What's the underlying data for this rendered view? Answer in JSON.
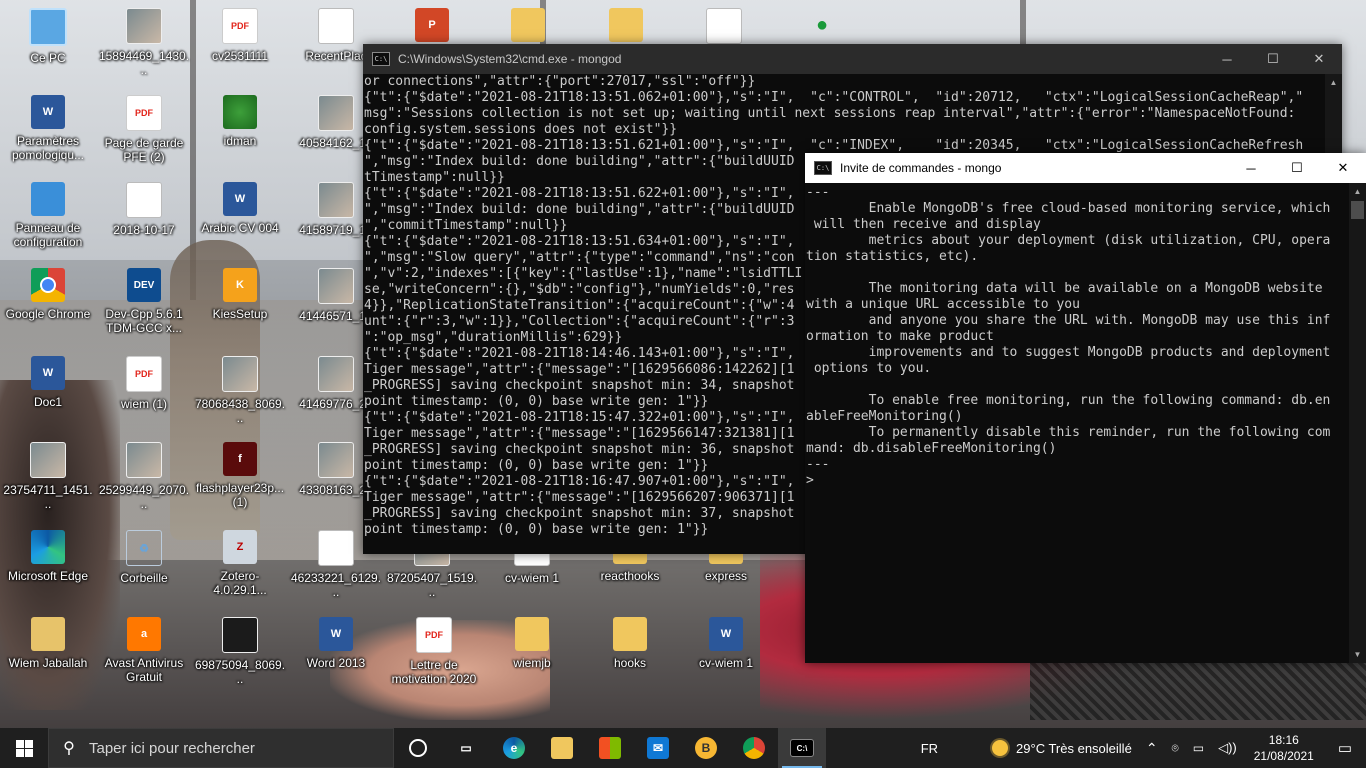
{
  "desktop": {
    "icons": [
      {
        "label": "Ce PC",
        "icon": "computer-icon"
      },
      {
        "label": "15894469_1430...",
        "icon": "photo-icon"
      },
      {
        "label": "cv2531111",
        "icon": "pdf-icon"
      },
      {
        "label": "RecentPlac",
        "icon": "recent-places-icon"
      },
      {
        "label": "Paramètres pomologiqu...",
        "icon": "word-doc-icon"
      },
      {
        "label": "Page de garde PFE (2)",
        "icon": "pdf-icon"
      },
      {
        "label": "idman",
        "icon": "idm-icon"
      },
      {
        "label": "40584162_19",
        "icon": "photo-icon"
      },
      {
        "label": "Panneau de configuration",
        "icon": "control-panel-icon"
      },
      {
        "label": "2018-10-17",
        "icon": "photo-icon"
      },
      {
        "label": "Arabic CV 004",
        "icon": "word-doc-icon"
      },
      {
        "label": "41589719_19",
        "icon": "photo-icon"
      },
      {
        "label": "Google Chrome",
        "icon": "chrome-icon"
      },
      {
        "label": "Dev-Cpp 5.6.1 TDM-GCC x...",
        "icon": "devcpp-icon"
      },
      {
        "label": "KiesSetup",
        "icon": "kies-icon"
      },
      {
        "label": "41446571_19",
        "icon": "photo-icon"
      },
      {
        "label": "Doc1",
        "icon": "word-doc-icon"
      },
      {
        "label": "wiem (1)",
        "icon": "pdf-icon"
      },
      {
        "label": "78068438_8069...",
        "icon": "photo-icon"
      },
      {
        "label": "41469776_22",
        "icon": "photo-icon"
      },
      {
        "label": "23754711_1451...",
        "icon": "photo-icon"
      },
      {
        "label": "25299449_2070...",
        "icon": "photo-icon"
      },
      {
        "label": "flashplayer23p... (1)",
        "icon": "flash-icon"
      },
      {
        "label": "43308163_21",
        "icon": "photo-icon"
      },
      {
        "label": "Microsoft Edge",
        "icon": "edge-icon"
      },
      {
        "label": "Corbeille",
        "icon": "recycle-bin-icon"
      },
      {
        "label": "Zotero-4.0.29.1...",
        "icon": "zotero-icon"
      },
      {
        "label": "46233221_6129...",
        "icon": "photo-icon"
      },
      {
        "label": "87205407_1519...",
        "icon": "photo-icon"
      },
      {
        "label": "cv-wiem 1",
        "icon": "pdf-icon"
      },
      {
        "label": "reacthooks",
        "icon": "folder-icon"
      },
      {
        "label": "express",
        "icon": "folder-icon"
      },
      {
        "label": "Wiem Jaballah",
        "icon": "user-folder-icon"
      },
      {
        "label": "Avast Antivirus Gratuit",
        "icon": "avast-icon"
      },
      {
        "label": "69875094_8069...",
        "icon": "photo-icon"
      },
      {
        "label": "Word 2013",
        "icon": "word-app-icon"
      },
      {
        "label": "Lettre de motivation 2020",
        "icon": "pdf-icon"
      },
      {
        "label": "wiemjb",
        "icon": "folder-icon"
      },
      {
        "label": "hooks",
        "icon": "folder-icon"
      },
      {
        "label": "cv-wiem 1",
        "icon": "word-doc-icon"
      }
    ]
  },
  "mongod_window": {
    "title": "C:\\Windows\\System32\\cmd.exe - mongod",
    "lines": [
      "or connections\",\"attr\":{\"port\":27017,\"ssl\":\"off\"}}",
      "{\"t\":{\"$date\":\"2021-08-21T18:13:51.062+01:00\"},\"s\":\"I\",  \"c\":\"CONTROL\",  \"id\":20712,   \"ctx\":\"LogicalSessionCacheReap\",\"",
      "msg\":\"Sessions collection is not set up; waiting until next sessions reap interval\",\"attr\":{\"error\":\"NamespaceNotFound:",
      "config.system.sessions does not exist\"}}",
      "{\"t\":{\"$date\":\"2021-08-21T18:13:51.621+01:00\"},\"s\":\"I\",  \"c\":\"INDEX\",    \"id\":20345,   \"ctx\":\"LogicalSessionCacheRefresh",
      "\",\"msg\":\"Index build: done building\",\"attr\":{\"buildUUID",
      "tTimestamp\":null}}",
      "{\"t\":{\"$date\":\"2021-08-21T18:13:51.622+01:00\"},\"s\":\"I\",",
      "\",\"msg\":\"Index build: done building\",\"attr\":{\"buildUUID",
      "\",\"commitTimestamp\":null}}",
      "{\"t\":{\"$date\":\"2021-08-21T18:13:51.634+01:00\"},\"s\":\"I\",",
      "\",\"msg\":\"Slow query\",\"attr\":{\"type\":\"command\",\"ns\":\"con",
      "\",\"v\":2,\"indexes\":[{\"key\":{\"lastUse\":1},\"name\":\"lsidTTLI",
      "se,\"writeConcern\":{},\"$db\":\"config\"},\"numYields\":0,\"res",
      "4}},\"ReplicationStateTransition\":{\"acquireCount\":{\"w\":4",
      "unt\":{\"r\":3,\"w\":1}},\"Collection\":{\"acquireCount\":{\"r\":3",
      "\":\"op_msg\",\"durationMillis\":629}}",
      "{\"t\":{\"$date\":\"2021-08-21T18:14:46.143+01:00\"},\"s\":\"I\",",
      "Tiger message\",\"attr\":{\"message\":\"[1629566086:142262][1",
      "_PROGRESS] saving checkpoint snapshot min: 34, snapshot",
      "point timestamp: (0, 0) base write gen: 1\"}}",
      "{\"t\":{\"$date\":\"2021-08-21T18:15:47.322+01:00\"},\"s\":\"I\",",
      "Tiger message\",\"attr\":{\"message\":\"[1629566147:321381][1",
      "_PROGRESS] saving checkpoint snapshot min: 36, snapshot",
      "point timestamp: (0, 0) base write gen: 1\"}}",
      "{\"t\":{\"$date\":\"2021-08-21T18:16:47.907+01:00\"},\"s\":\"I\",",
      "Tiger message\",\"attr\":{\"message\":\"[1629566207:906371][1",
      "_PROGRESS] saving checkpoint snapshot min: 37, snapshot",
      "point timestamp: (0, 0) base write gen: 1\"}}"
    ]
  },
  "mongo_window": {
    "title": "Invite de commandes - mongo",
    "lines": [
      "---",
      "        Enable MongoDB's free cloud-based monitoring service, which",
      " will then receive and display",
      "        metrics about your deployment (disk utilization, CPU, opera",
      "tion statistics, etc).",
      "",
      "        The monitoring data will be available on a MongoDB website",
      "with a unique URL accessible to you",
      "        and anyone you share the URL with. MongoDB may use this inf",
      "ormation to make product",
      "        improvements and to suggest MongoDB products and deployment",
      " options to you.",
      "",
      "        To enable free monitoring, run the following command: db.en",
      "ableFreeMonitoring()",
      "        To permanently disable this reminder, run the following com",
      "mand: db.disableFreeMonitoring()",
      "---",
      ">"
    ]
  },
  "window_controls": {
    "minimize": "─",
    "maximize": "☐",
    "close": "✕"
  },
  "taskbar": {
    "search_placeholder": "Taper ici pour rechercher",
    "apps": [
      {
        "name": "task-view",
        "glyph": "▭"
      },
      {
        "name": "edge",
        "glyph": "e"
      },
      {
        "name": "file-explorer",
        "glyph": "📁"
      },
      {
        "name": "microsoft-store",
        "glyph": "🛍"
      },
      {
        "name": "mail",
        "glyph": "✉"
      },
      {
        "name": "brave",
        "glyph": "B"
      },
      {
        "name": "chrome",
        "glyph": "◉"
      },
      {
        "name": "cmd",
        "glyph": "C:\\"
      }
    ],
    "language": "FR",
    "weather": "29°C  Très ensoleillé",
    "time": "18:16",
    "date": "21/08/2021"
  }
}
